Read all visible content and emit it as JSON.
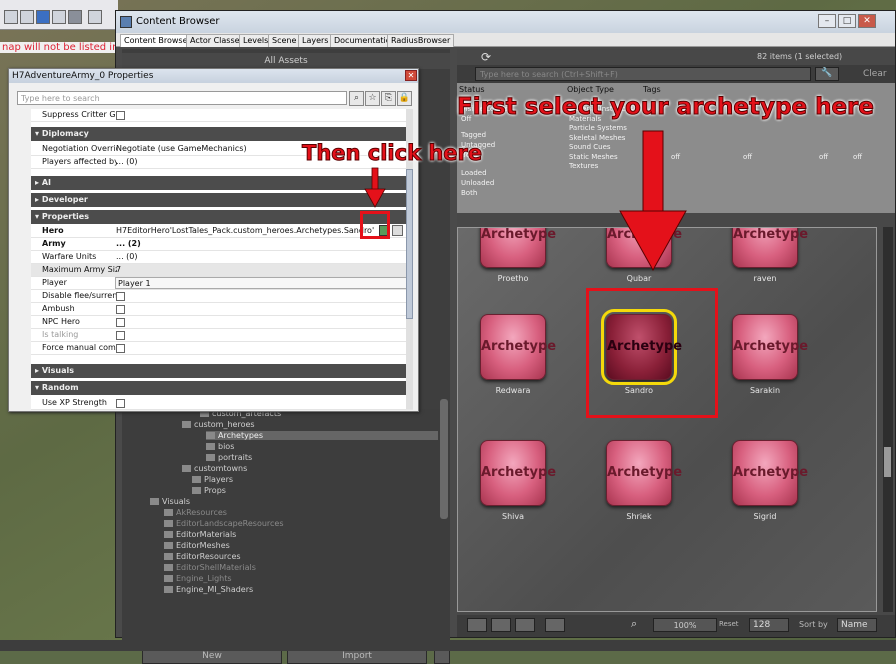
{
  "background_notice": "nap will not be listed in",
  "content_browser": {
    "title": "Content Browser",
    "tabs": [
      "Content Browser",
      "Actor Classes",
      "Levels",
      "Scene",
      "Layers",
      "Documentation",
      "RadiusBrowser"
    ],
    "all_assets_label": "All Assets",
    "item_count": "82 items (1 selected)",
    "search_placeholder": "Type here to search (Ctrl+Shift+F)",
    "clear_label": "Clear",
    "filter_columns": {
      "status": "Status",
      "object_type": "Object Type",
      "tags": "Tags"
    },
    "status_options": [
      "Visible Levels",
      "Off",
      "Tagged",
      "Untagged",
      "Both",
      "Loaded",
      "Unloaded",
      "Both"
    ],
    "object_types": [
      "Material Instances",
      "Materials",
      "Particle Systems",
      "Skeletal Meshes",
      "Sound Cues",
      "Static Meshes",
      "Textures"
    ],
    "tag_values": [
      "off",
      "off",
      "off",
      "off"
    ],
    "tree": [
      {
        "label": "custom_artefacts",
        "dim": false
      },
      {
        "label": "custom_heroes",
        "dim": false
      },
      {
        "label": "Archetypes",
        "dim": false,
        "selected": true
      },
      {
        "label": "bios",
        "dim": false
      },
      {
        "label": "portraits",
        "dim": false
      },
      {
        "label": "customtowns",
        "dim": false
      },
      {
        "label": "Players",
        "dim": false
      },
      {
        "label": "Props",
        "dim": false
      },
      {
        "label": "Visuals",
        "dim": false
      },
      {
        "label": "AkResources",
        "dim": true
      },
      {
        "label": "EditorLandscapeResources",
        "dim": true
      },
      {
        "label": "EditorMaterials",
        "dim": false
      },
      {
        "label": "EditorMeshes",
        "dim": false
      },
      {
        "label": "EditorResources",
        "dim": false
      },
      {
        "label": "EditorShellMaterials",
        "dim": true
      },
      {
        "label": "Engine_Lights",
        "dim": true
      },
      {
        "label": "Engine_MI_Shaders",
        "dim": false
      }
    ],
    "new_label": "New",
    "import_label": "Import",
    "tile_text": "Archetype",
    "tiles": [
      {
        "name": "Proetho"
      },
      {
        "name": "Qubar"
      },
      {
        "name": "raven"
      },
      {
        "name": "Redwara"
      },
      {
        "name": "Sandro",
        "selected": true
      },
      {
        "name": "Sarakin"
      },
      {
        "name": "Shiva"
      },
      {
        "name": "Shriek"
      },
      {
        "name": "Sigrid"
      }
    ],
    "zoom": "100%",
    "reset_label": "Reset",
    "thumb_size": "128",
    "sort_by_label": "Sort by",
    "sort_value": "Name"
  },
  "properties": {
    "title": "H7AdventureArmy_0 Properties",
    "search_placeholder": "Type here to search",
    "rows": {
      "suppress": "Suppress Critter Grou",
      "cat_diplomacy": "Diplomacy",
      "negotiation_name": "Negotiation Override",
      "negotiation_value": "Negotiate (use GameMechanics)",
      "players_affected_name": "Players affected by N",
      "players_affected_value": "... (0)",
      "cat_ai": "AI",
      "cat_developer": "Developer",
      "cat_properties": "Properties",
      "hero_name": "Hero",
      "hero_value": "H7EditorHero'LostTales_Pack.custom_heroes.Archetypes.Sandro'",
      "army_name": "Army",
      "army_value": "... (2)",
      "warfare_name": "Warfare Units",
      "warfare_value": "... (0)",
      "max_army_name": "Maximum Army Size",
      "max_army_value": "7",
      "player_name": "Player",
      "player_value": "Player 1",
      "disable_flee": "Disable flee/surrende",
      "ambush": "Ambush",
      "npc_hero": "NPC Hero",
      "is_talking": "Is talking",
      "force_manual": "Force manual combat",
      "cat_visuals": "Visuals",
      "cat_random": "Random",
      "use_xp": "Use XP Strength"
    }
  },
  "annotations": {
    "select_text": "First select your archetype here",
    "click_text": "Then click here"
  },
  "colors": {
    "annotation_red": "#e4111a",
    "selection_yellow": "#f4d90b",
    "tile_pink": "#d8607f"
  }
}
